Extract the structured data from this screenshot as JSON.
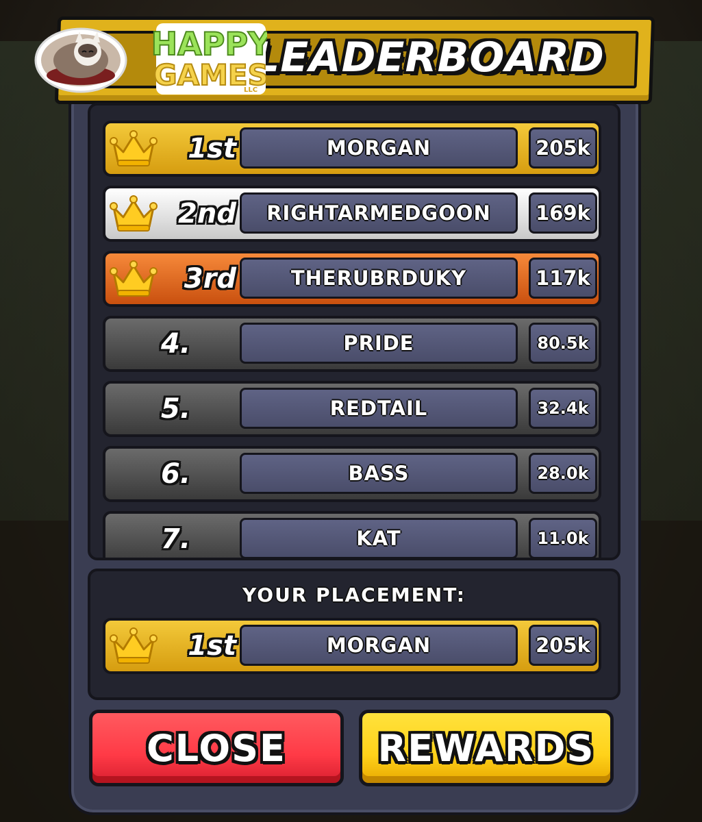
{
  "header": {
    "title": "LEADERBOARD",
    "logo_text_top": "HAPPY",
    "logo_text_bottom": "GAMES",
    "logo_suffix": "LLC"
  },
  "leaderboard": {
    "rows": [
      {
        "rank": "1st",
        "name": "MORGAN",
        "score": "205k",
        "tier": "gold",
        "crown": true
      },
      {
        "rank": "2nd",
        "name": "RIGHTARMEDGOON",
        "score": "169k",
        "tier": "silver",
        "crown": true
      },
      {
        "rank": "3rd",
        "name": "THERUBRDUKY",
        "score": "117k",
        "tier": "bronze",
        "crown": true
      },
      {
        "rank": "4.",
        "name": "PRIDE",
        "score": "80.5k",
        "tier": "grey",
        "crown": false
      },
      {
        "rank": "5.",
        "name": "REDTAIL",
        "score": "32.4k",
        "tier": "grey",
        "crown": false
      },
      {
        "rank": "6.",
        "name": "BASS",
        "score": "28.0k",
        "tier": "grey",
        "crown": false
      },
      {
        "rank": "7.",
        "name": "KAT",
        "score": "11.0k",
        "tier": "grey",
        "crown": false
      }
    ]
  },
  "placement": {
    "label": "YOUR PLACEMENT:",
    "rank": "1st",
    "name": "MORGAN",
    "score": "205k",
    "tier": "gold"
  },
  "buttons": {
    "close_label": "CLOSE",
    "rewards_label": "REWARDS"
  },
  "icons": {
    "crown": "crown-icon",
    "logo": "cat-logo-icon"
  },
  "colors": {
    "gold": "#e0b21c",
    "silver": "#e6e6e6",
    "bronze": "#e8702a",
    "close": "#ff3a46",
    "rewards": "#ffd21a",
    "panel": "#3a3d52"
  }
}
